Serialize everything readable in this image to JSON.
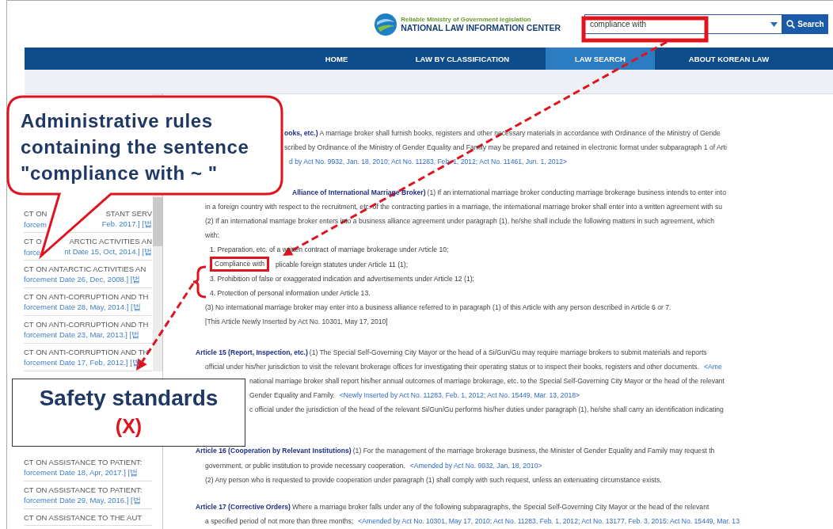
{
  "header": {
    "logo_tagline": "Reliable Ministry of Government legislation",
    "logo_title": "NATIONAL LAW INFORMATION CENTER",
    "search": {
      "value": "compliance with",
      "button": "Search"
    }
  },
  "nav": [
    {
      "label": "HOME",
      "selected": false
    },
    {
      "label": "LAW BY CLASSIFICATION",
      "selected": false
    },
    {
      "label": "LAW SEARCH",
      "selected": true
    },
    {
      "label": "ABOUT KOREAN LAW",
      "selected": false
    }
  ],
  "sidebar": {
    "items": [
      {
        "title": [
          "CT ON",
          "STANT SERV"
        ],
        "date": [
          "forcem",
          "Feb. 2017.] [법"
        ]
      },
      {
        "title": [
          "CT O",
          "ARCTIC ACTIVITIES AN"
        ],
        "date": [
          "force",
          "nt Date 15, Oct, 2014.] [법"
        ]
      },
      {
        "title": [
          "CT ON ANTARCTIC ACTIVITIES AN"
        ],
        "date": [
          "forcement Date 26, Dec, 2008.] [법"
        ]
      },
      {
        "title": [
          "CT ON ANTI-CORRUPTION AND TH"
        ],
        "date": [
          "forcement Date 28, May, 2014.] [법"
        ]
      },
      {
        "title": [
          "CT ON ANTI-CORRUPTION AND TH"
        ],
        "date": [
          "forcement Date 23, Mar, 2013.] [법"
        ]
      },
      {
        "title": [
          "CT ON ANTI-CORRUPTION AND TH"
        ],
        "date": [
          "forcement Date 17, Feb, 2012.] [법"
        ]
      },
      {
        "title": [
          "CT ON ASSISTANCE TO PATIENT:"
        ],
        "date": [
          "forcement Date 18, Apr, 2017.] [법"
        ]
      },
      {
        "title": [
          "CT ON ASSISTANCE TO PATIENT:"
        ],
        "date": [
          "forcement Date 29, May, 2016.] [법"
        ]
      },
      {
        "title": [
          "CT ON ASSISTANCE TO THE AUT"
        ]
      }
    ]
  },
  "articles": [
    {
      "lines": [
        {
          "kind": "para",
          "segments": [
            {
              "kind": "bold",
              "text": "ooks, etc.)"
            },
            {
              "kind": "plain",
              "text": "A marriage broker shall furnish books, registers and other necessary materials in accordance with Ordinance of the Ministry of Gende"
            }
          ]
        },
        {
          "kind": "para",
          "segments": [
            {
              "kind": "plain",
              "text": "scribed by Ordinance of the Ministry of Gender Equality and Family may be prepared and retained in electronic format under subparagraph 1 of Arti"
            }
          ]
        },
        {
          "kind": "para",
          "segments": [
            {
              "kind": "link",
              "text": "d by Act No. 9932, Jan. 18, 2010; Act No. 11283, Feb. 1, 2012; Act No. 11461, Jun. 1, 2012>"
            }
          ]
        }
      ]
    },
    {
      "lines": [
        {
          "kind": "heading",
          "segments": [
            {
              "kind": "bold",
              "text": "Alliance of International Marriage Broker)"
            },
            {
              "kind": "plain",
              "text": "(1) If an international marriage broker conducting marriage brokerage business intends to enter into"
            }
          ]
        },
        {
          "kind": "para",
          "segments": [
            {
              "kind": "plain",
              "text": "in a foreign country with respect to the recruitment, etc. of the contracting parties in a marriage, the international marriage broker shall enter into a written agreement with su"
            }
          ]
        },
        {
          "kind": "para",
          "segments": [
            {
              "kind": "plain",
              "text": "(2) If an international marriage broker enters into a business alliance agreement under paragraph (1), he/she shall include the following matters in such agreement, which"
            }
          ]
        },
        {
          "kind": "para",
          "segments": [
            {
              "kind": "plain",
              "text": "with:"
            }
          ]
        },
        {
          "kind": "item",
          "segments": [
            {
              "kind": "plain",
              "text": "1. Preparation, etc. of a written contract of marriage brokerage under Article 10;"
            }
          ]
        },
        {
          "kind": "item",
          "segments": [
            {
              "kind": "boxed",
              "text": "Compliance with"
            },
            {
              "kind": "plain",
              "text": "plicable foreign statutes under Article 11 (1);"
            }
          ]
        },
        {
          "kind": "item",
          "segments": [
            {
              "kind": "plain",
              "text": "3. Prohibition of false or exaggerated indication and advertisements under Article 12 (1);"
            }
          ]
        },
        {
          "kind": "item",
          "segments": [
            {
              "kind": "plain",
              "text": "4. Protection of personal information under Article 13."
            }
          ]
        },
        {
          "kind": "para",
          "segments": [
            {
              "kind": "plain",
              "text": "(3) No international marriage broker may enter into a business alliance referred to in paragraph (1) of this Article with any person described in Article 6 or 7."
            }
          ]
        },
        {
          "kind": "para",
          "segments": [
            {
              "kind": "plain",
              "text": "[This Article Newly Inserted by Act No. 10301, May 17, 2010]"
            }
          ]
        }
      ]
    },
    {
      "lines": [
        {
          "kind": "heading",
          "segments": [
            {
              "kind": "bold",
              "text": "Article 15 (Report, Inspection, etc.)"
            },
            {
              "kind": "plain",
              "text": "(1) The Special Self-Governing City Mayor or the head of a Si/Gun/Gu may require marriage brokers to submit materials and reports"
            }
          ]
        },
        {
          "kind": "para",
          "segments": [
            {
              "kind": "plain",
              "text": "official under his/her jurisdiction to visit the relevant brokerage offices for investigating their operating status or to inspect their books, registers and other documents."
            },
            {
              "kind": "link",
              "text": "<Ame"
            }
          ]
        },
        {
          "kind": "para",
          "segments": [
            {
              "kind": "plain",
              "text": "national marriage broker shall report his/her annual outcomes of marriage brokerage, etc. to the Special Self-Governing City Mayor or the head of the relevant"
            }
          ]
        },
        {
          "kind": "para",
          "segments": [
            {
              "kind": "plain",
              "text": "Gender Equality and Family."
            },
            {
              "kind": "link",
              "text": "<Newly Inserted by Act No. 11283, Feb. 1, 2012; Act No. 15449, Mar. 13, 2018>"
            }
          ]
        },
        {
          "kind": "para",
          "segments": [
            {
              "kind": "plain",
              "text": "c official under the jurisdiction of the head of the relevant Si/Gun/Gu performs his/her duties under paragraph (1), he/she shall carry an identification indicating"
            }
          ]
        }
      ]
    },
    {
      "lines": [
        {
          "kind": "heading",
          "segments": [
            {
              "kind": "bold",
              "text": "Article 16 (Cooperation by Relevant Institutions)"
            },
            {
              "kind": "plain",
              "text": "(1) For the management of the marriage brokerage business, the Minister of Gender Equality and Family may request th"
            }
          ]
        },
        {
          "kind": "para",
          "segments": [
            {
              "kind": "plain",
              "text": "government, or public institution to provide necessary cooperation."
            },
            {
              "kind": "link",
              "text": "<Amended by Act No. 9932, Jan. 18, 2010>"
            }
          ]
        },
        {
          "kind": "para",
          "segments": [
            {
              "kind": "plain",
              "text": "(2) Any person who is requested to provide cooperation under paragraph (1) shall comply with such request, unless an extenuating circumstance exists."
            }
          ]
        }
      ]
    },
    {
      "lines": [
        {
          "kind": "heading",
          "segments": [
            {
              "kind": "bold",
              "text": "Article 17 (Corrective Orders)"
            },
            {
              "kind": "plain",
              "text": "Where a marriage broker falls under any of the following subparagraphs, the Special Self-Governing City Mayor or the head of the relevant"
            }
          ]
        },
        {
          "kind": "para",
          "segments": [
            {
              "kind": "plain",
              "text": "a specified period of not more than three months;"
            },
            {
              "kind": "link",
              "text": "<Amended by Act No. 10301, May 17, 2010; Act No. 11283, Feb. 1, 2012; Act No. 13177, Feb. 3, 2015; Act No. 15449, Mar. 13"
            }
          ]
        }
      ]
    }
  ],
  "annotations": {
    "callout": [
      "Administrative rules",
      "containing the sentence",
      "\"compliance with ~ \""
    ],
    "note": {
      "title": "Safety standards",
      "mark": "(X)"
    }
  }
}
